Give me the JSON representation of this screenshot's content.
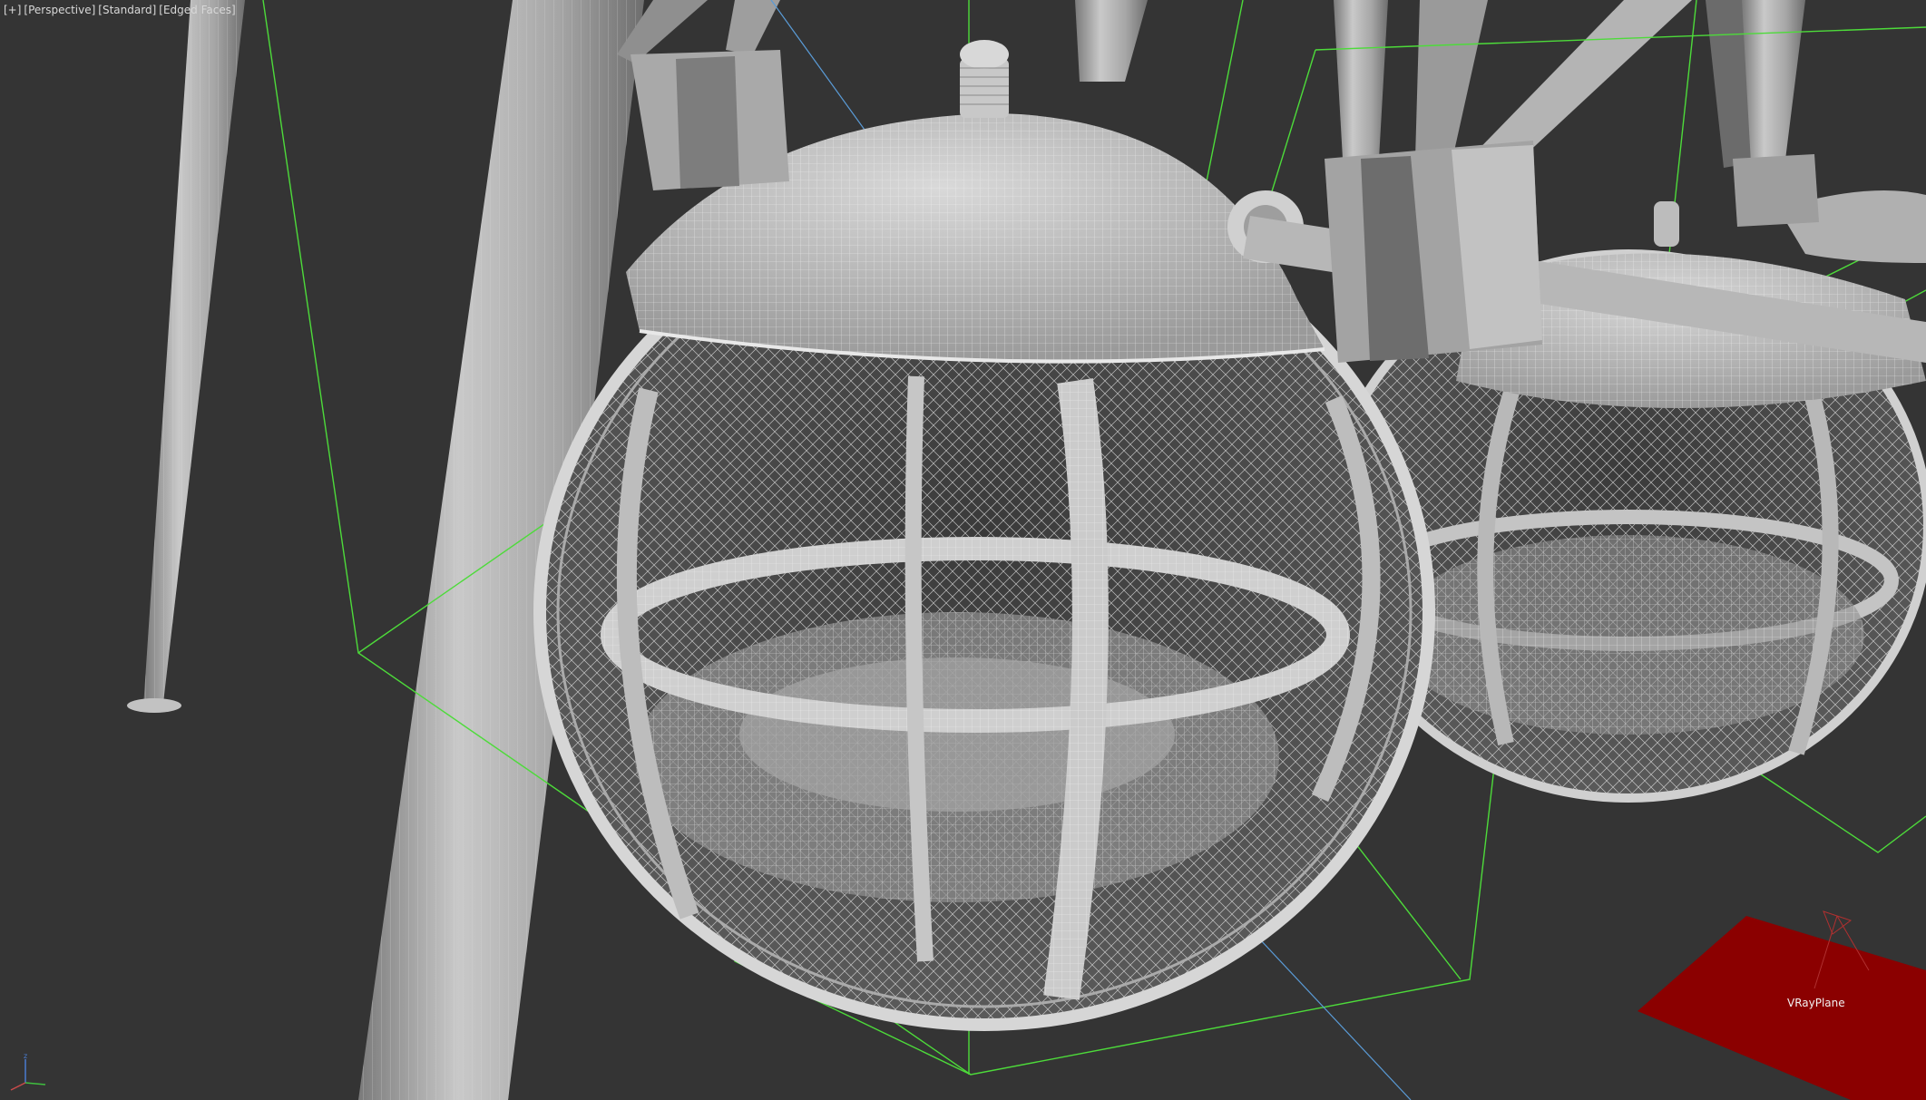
{
  "viewport": {
    "labels": {
      "menu": "[+]",
      "view": "[Perspective]",
      "shading_mode": "[Standard]",
      "display_mode": "[Edged Faces]"
    },
    "background_color": "#343434",
    "objects": [
      {
        "id": "ferris-cabin-front",
        "type": "mesh"
      },
      {
        "id": "ferris-cabin-back",
        "type": "mesh"
      },
      {
        "id": "support-pillars",
        "type": "mesh"
      },
      {
        "id": "vray-plane",
        "type": "light",
        "label": "VRayPlane",
        "color": "#8b0000"
      }
    ],
    "colors": {
      "mesh": "#bdbdbd",
      "wire": "#f0f0f0",
      "selection_box": "#4ddb3a",
      "axis_blue": "#5a9bd6"
    }
  }
}
